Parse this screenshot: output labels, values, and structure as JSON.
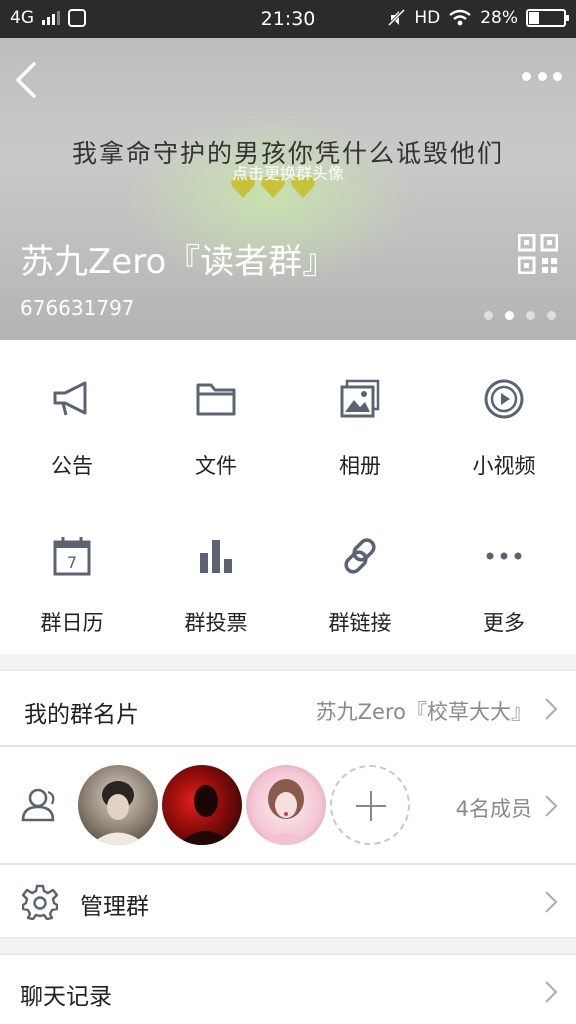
{
  "status_bar": {
    "network": "4G",
    "time": "21:30",
    "hd": "HD",
    "battery_text": "28%",
    "battery_level": 0.28
  },
  "header": {
    "calligraphy": "我拿命守护的男孩你凭什么诋毁他们",
    "change_avatar_hint": "点击更换群头像",
    "group_name": "苏九Zero『读者群』",
    "group_id": "676631797",
    "page_dots": 4,
    "active_dot": 2
  },
  "features": [
    {
      "label": "公告",
      "icon": "megaphone-icon"
    },
    {
      "label": "文件",
      "icon": "folder-icon"
    },
    {
      "label": "相册",
      "icon": "photo-album-icon"
    },
    {
      "label": "小视频",
      "icon": "video-play-icon"
    },
    {
      "label": "群日历",
      "icon": "calendar-icon"
    },
    {
      "label": "群投票",
      "icon": "bar-chart-icon"
    },
    {
      "label": "群链接",
      "icon": "link-icon"
    },
    {
      "label": "更多",
      "icon": "more-dots-icon"
    }
  ],
  "group_card": {
    "title": "我的群名片",
    "value": "苏九Zero『校草大大』"
  },
  "members": {
    "count_text": "4名成员"
  },
  "manage": {
    "title": "管理群"
  },
  "chat_history": {
    "title": "聊天记录"
  },
  "colors": {
    "icon": "#5b6373",
    "text": "#222222",
    "secondary": "#8a8a8a"
  }
}
